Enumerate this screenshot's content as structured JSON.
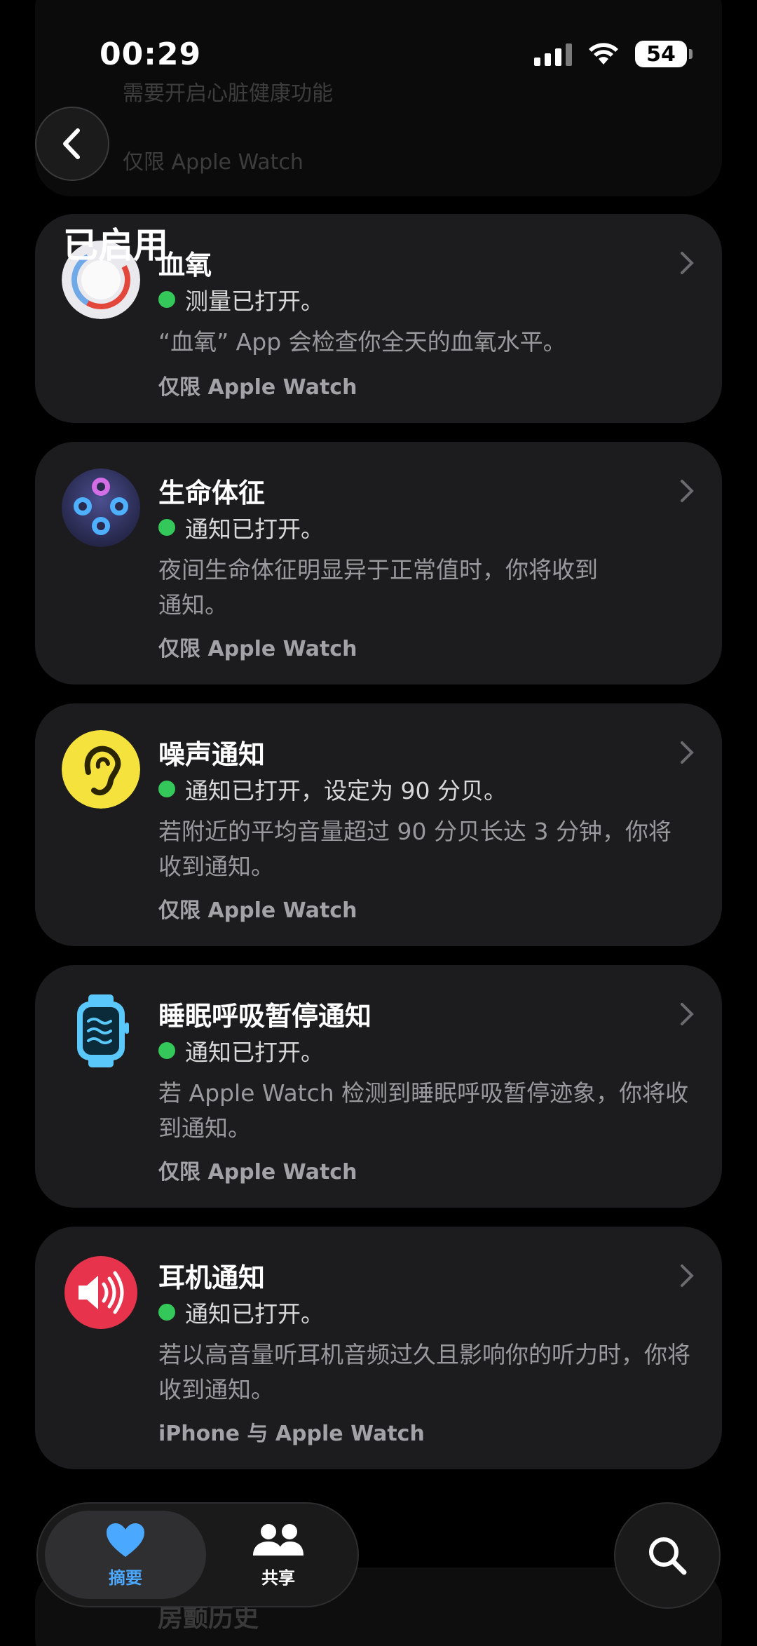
{
  "status_bar": {
    "time": "00:29",
    "battery": "54"
  },
  "ghost_top": {
    "line1": "需要开启心脏健康功能",
    "line2": "仅限 Apple Watch"
  },
  "section_title": "已启用",
  "cards": [
    {
      "title": "血氧",
      "status": "测量已打开。",
      "desc": "“血氧” App 会检查你全天的血氧水平。",
      "scope": "仅限 Apple Watch",
      "icon": "blood-oxygen-icon"
    },
    {
      "title": "生命体征",
      "status": "通知已打开。",
      "desc": "夜间生命体征明显异于正常值时，你将收到通知。",
      "scope": "仅限 Apple Watch",
      "icon": "vitals-icon"
    },
    {
      "title": "噪声通知",
      "status": "通知已打开，设定为 90 分贝。",
      "desc": "若附近的平均音量超过 90 分贝长达 3 分钟，你将收到通知。",
      "scope": "仅限 Apple Watch",
      "icon": "ear-icon"
    },
    {
      "title": "睡眠呼吸暂停通知",
      "status": "通知已打开。",
      "desc": "若 Apple Watch 检测到睡眠呼吸暂停迹象，你将收到通知。",
      "scope": "仅限 Apple Watch",
      "icon": "watch-breathing-icon"
    },
    {
      "title": "耳机通知",
      "status": "通知已打开。",
      "desc": "若以高音量听耳机音频过久且影响你的听力时，你将收到通知。",
      "scope": "iPhone 与 Apple Watch",
      "icon": "speaker-icon"
    }
  ],
  "tabs": [
    {
      "label": "摘要",
      "icon": "heart-icon",
      "active": true
    },
    {
      "label": "共享",
      "icon": "people-icon",
      "active": false
    }
  ],
  "bottom_ghost": {
    "title": "房颤历史"
  },
  "colors": {
    "status_dot": "#34c759",
    "active_tab": "#4aa8ff",
    "card_bg": "#1c1c1e"
  }
}
